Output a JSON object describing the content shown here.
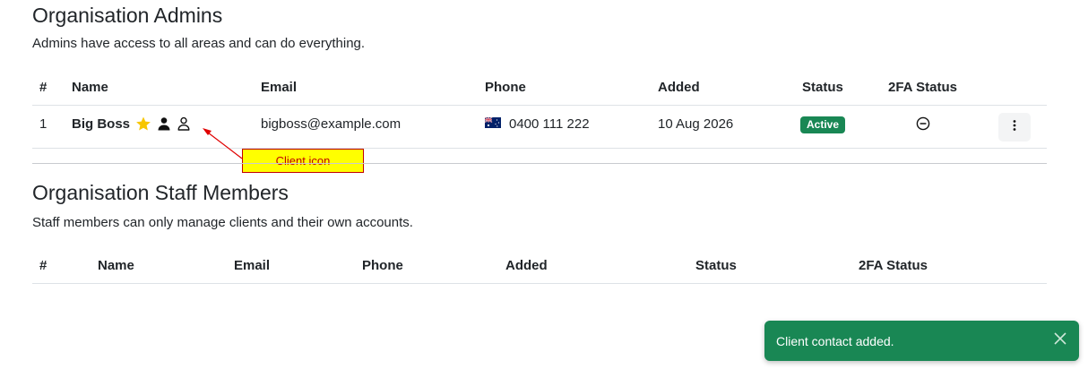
{
  "admins": {
    "title": "Organisation Admins",
    "description": "Admins have access to all areas and can do everything.",
    "columns": [
      "#",
      "Name",
      "Email",
      "Phone",
      "Added",
      "Status",
      "2FA Status"
    ],
    "rows": [
      {
        "index": "1",
        "name": "Big Boss",
        "email": "bigboss@example.com",
        "phone": "0400 111 222",
        "flag": "australia-flag",
        "added": "10 Aug 2026",
        "status": "Active",
        "twofa_icon": "minus-circle-icon",
        "row_icons": [
          "star-icon",
          "user-icon",
          "client-user-outline-icon"
        ],
        "actions_icon": "kebab-icon"
      }
    ]
  },
  "staff": {
    "title": "Organisation Staff Members",
    "description": "Staff members can only manage clients and their own accounts.",
    "columns": [
      "#",
      "Name",
      "Email",
      "Phone",
      "Added",
      "Status",
      "2FA Status"
    ]
  },
  "annotation": {
    "label": "Client icon"
  },
  "toast": {
    "message": "Client contact added.",
    "close_icon": "close-icon"
  },
  "colors": {
    "success": "#198754",
    "star": "#f7c600",
    "annotation_fill": "#ffff00",
    "annotation_red": "#c00000"
  }
}
